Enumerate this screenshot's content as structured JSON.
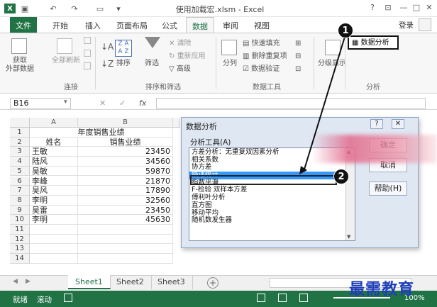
{
  "window": {
    "title": "使用加载宏.xlsm - Excel",
    "login": "登录",
    "controls": [
      "?",
      "⊡",
      "—",
      "□",
      "✕"
    ]
  },
  "tabs": [
    "文件",
    "开始",
    "插入",
    "页面布局",
    "公式",
    "数据",
    "审阅",
    "视图"
  ],
  "ribbon": {
    "get_external": "获取\n外部数据",
    "refresh_all": "全部刷新",
    "sort": "排序",
    "filter": "筛选",
    "clear": "清除",
    "reapply": "重新应用",
    "advanced": "高级",
    "split": "分列",
    "flash_fill": "快速填充",
    "remove_dup": "删除重复项",
    "validation": "数据验证",
    "outline": "分级显示",
    "data_analysis": "数据分析",
    "group_connections": "连接",
    "group_sort_filter": "排序和筛选",
    "group_data_tools": "数据工具",
    "group_analysis": "分析"
  },
  "formula_bar": {
    "namebox": "B16",
    "fx": "fx"
  },
  "sheet": {
    "columns": [
      "A",
      "B"
    ],
    "title": "年度销售业绩",
    "headers": [
      "姓名",
      "销售业绩"
    ],
    "rows": [
      [
        "王敏",
        "23450"
      ],
      [
        "陆风",
        "34560"
      ],
      [
        "吴敏",
        "59870"
      ],
      [
        "李峰",
        "21870"
      ],
      [
        "吴风",
        "17890"
      ],
      [
        "李明",
        "32560"
      ],
      [
        "吴雷",
        "23450"
      ],
      [
        "李明",
        "45630"
      ]
    ],
    "row_numbers": [
      "1",
      "2",
      "3",
      "4",
      "5",
      "6",
      "7",
      "8",
      "9",
      "10",
      "11",
      "12",
      "13",
      "14"
    ]
  },
  "sheet_tabs": [
    "Sheet1",
    "Sheet2",
    "Sheet3"
  ],
  "status": {
    "ready": "就绪",
    "scroll": "滚动",
    "zoom": "100%"
  },
  "dialog": {
    "title": "数据分析",
    "group_label": "分析工具(A)",
    "items": [
      "方差分析：无重复双因素分析",
      "相关系数",
      "协方差",
      "描述统计",
      "指数平滑",
      "F-检验 双样本方差",
      "傅利叶分析",
      "直方图",
      "移动平均",
      "随机数发生器"
    ],
    "selected_index": 3,
    "ok": "确定",
    "cancel": "取消",
    "help": "帮助(H)"
  },
  "callouts": [
    "1",
    "2"
  ],
  "watermark": "最需教育"
}
